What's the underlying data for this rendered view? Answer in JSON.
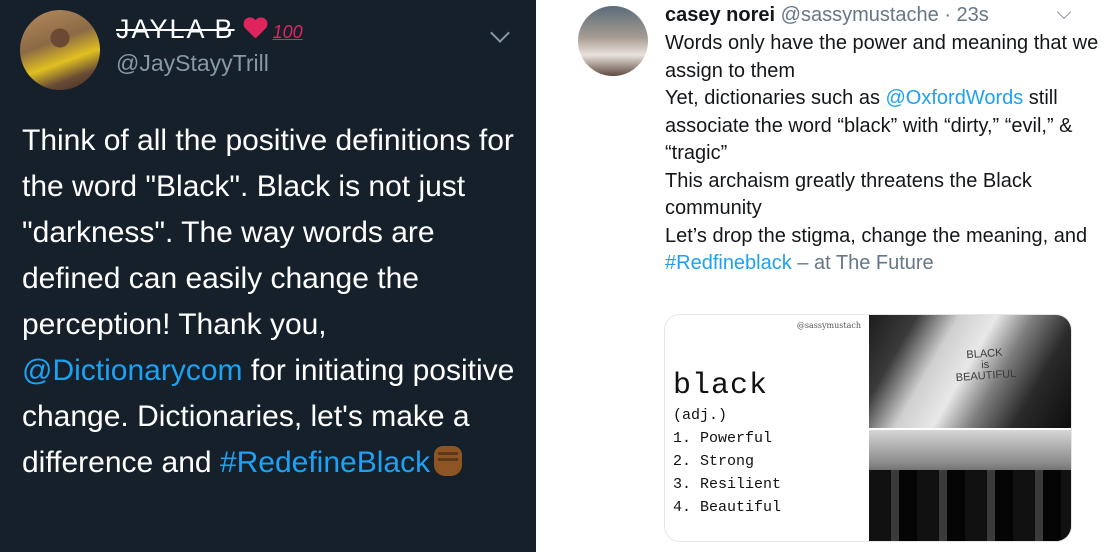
{
  "left_tweet": {
    "display_name": "JAYLA B",
    "badge_100": "100",
    "handle": "@JayStayyTrill",
    "text_before_mention": "Think of all the positive definitions for the word \"Black\". Black is not just \"darkness\". The way words are defined can easily change the perception! Thank you, ",
    "mention": "@Dictionarycom",
    "text_after_mention": " for initiating positive change. Dictionaries, let's make a difference and ",
    "hashtag": "#RedefineBlack",
    "emoji": "raised-fist-dark-skin"
  },
  "right_tweet": {
    "display_name": "casey norei",
    "handle": "@sassymustache",
    "time": "· 23s",
    "line1": "Words only have the power and meaning that we assign to them",
    "line2_before": "Yet, dictionaries such as ",
    "mention": "@OxfordWords",
    "line2_after": " still associate the word “black” with “dirty,” “evil,” & “tragic”",
    "line3": "This archaism greatly threatens the Black community",
    "line4_before": "Let’s drop the stigma, change the meaning, and ",
    "hashtag": "#Redfineblack",
    "place": " – at The Future",
    "card": {
      "watermark": "@sassymustach",
      "word": "black",
      "pos": "(adj.)",
      "definitions": [
        "1. Powerful",
        "2. Strong",
        "3. Resilient",
        "4. Beautiful"
      ]
    },
    "photo1_text": [
      "BLACK",
      "is",
      "BEAUTIFUL"
    ]
  },
  "colors": {
    "dark_bg": "#15202b",
    "link_blue": "#1da1f2",
    "heart": "#e0245e",
    "muted": "#657786"
  }
}
